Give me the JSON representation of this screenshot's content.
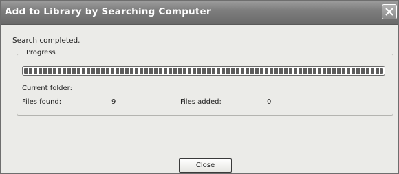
{
  "window": {
    "title": "Add to Library by Searching Computer",
    "close_icon": "close-icon"
  },
  "status": {
    "message": "Search completed."
  },
  "progress": {
    "legend": "Progress",
    "value_percent": 100,
    "current_folder_label": "Current folder:",
    "current_folder_value": "",
    "files_found_label": "Files found:",
    "files_found_value": "9",
    "files_added_label": "Files added:",
    "files_added_value": "0"
  },
  "buttons": {
    "close_label": "Close"
  },
  "colors": {
    "titlebar": "#7e7e7e",
    "window_bg": "#ebebe8",
    "progress_fill": "#5c5c5c"
  }
}
